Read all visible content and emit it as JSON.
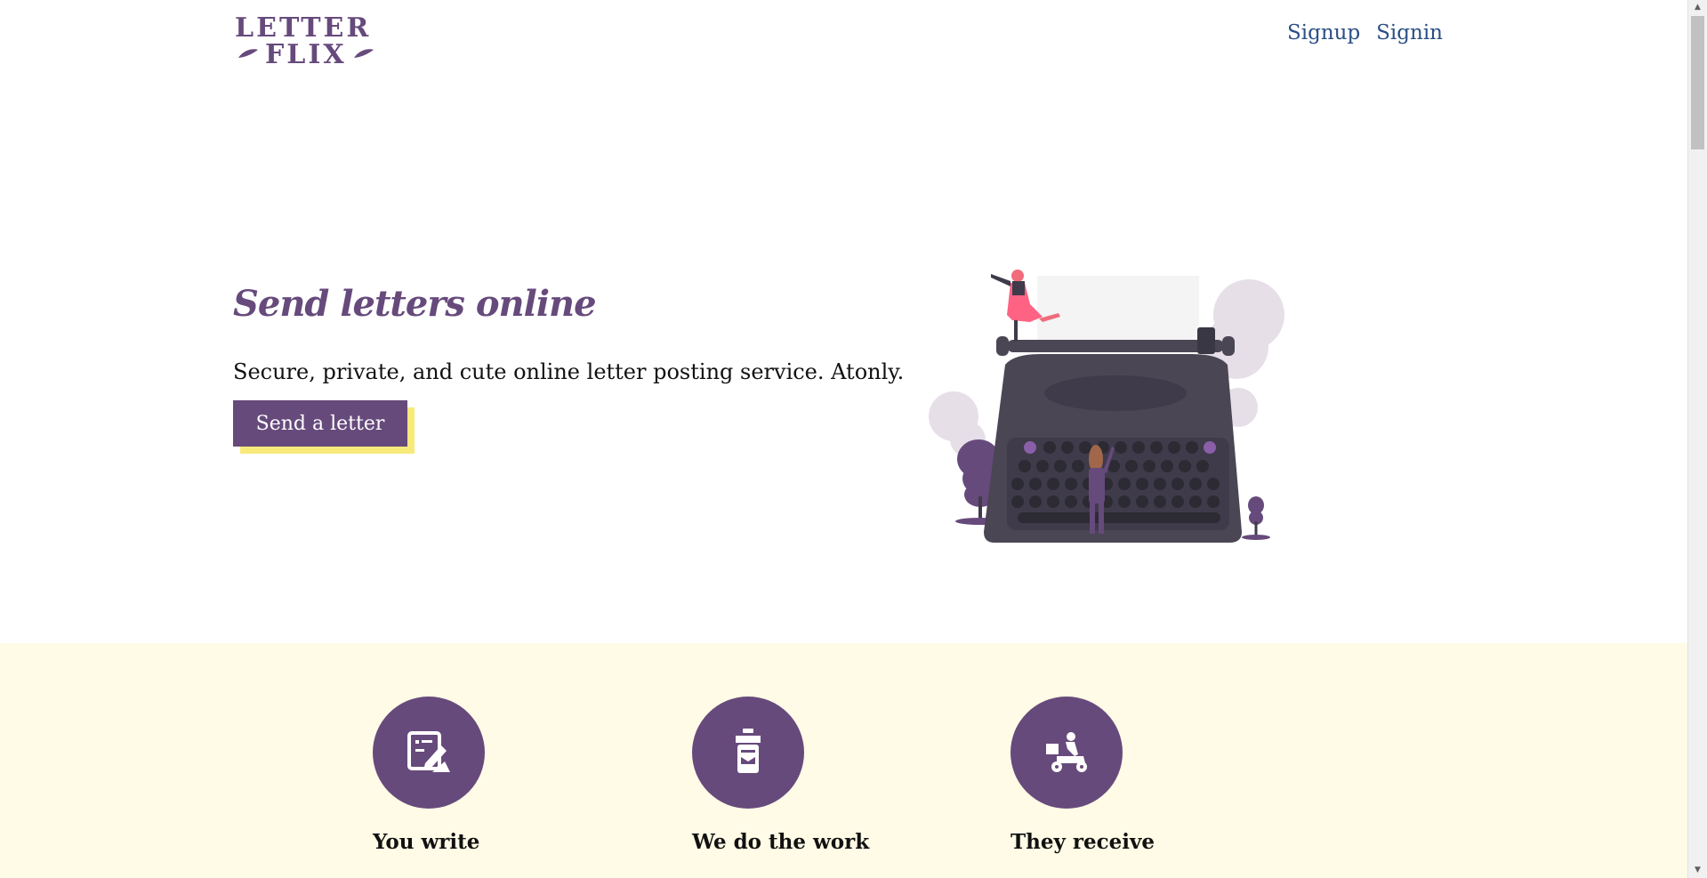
{
  "header": {
    "logo_line1": "LETTER",
    "logo_line2": "FLIX",
    "nav": [
      {
        "label": "Signup"
      },
      {
        "label": "Signin"
      }
    ]
  },
  "hero": {
    "title": "Send letters online",
    "subtitle": "Secure, private, and cute online letter posting service. Atonly.",
    "cta_label": "Send a letter",
    "illustration_icon": "typewriter-illustration"
  },
  "features": [
    {
      "label": "You write",
      "icon": "write-letter-icon"
    },
    {
      "label": "We do the work",
      "icon": "postbox-icon"
    },
    {
      "label": "They receive",
      "icon": "delivery-scooter-icon"
    }
  ],
  "colors": {
    "brand": "#674a7c",
    "accent_yellow": "#f8ea7a",
    "feature_bg": "#fffbe6",
    "link": "#2b4f86"
  }
}
